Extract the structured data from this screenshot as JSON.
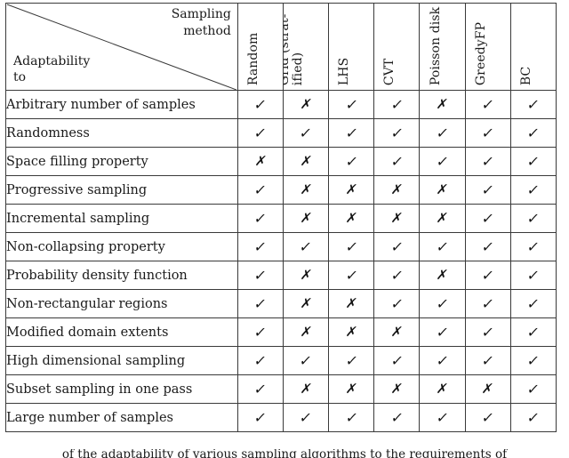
{
  "table": {
    "corner": {
      "top_right_line1": "Sampling",
      "top_right_line2": "method",
      "bottom_left_line1": "Adaptability",
      "bottom_left_line2": "to"
    },
    "columns": [
      {
        "label": "Random",
        "two_line": false
      },
      {
        "label": "Grid (strat-ified)",
        "two_line": true,
        "line1": "Grid  (strat-",
        "line2": "ified)"
      },
      {
        "label": "LHS",
        "two_line": false
      },
      {
        "label": "CVT",
        "two_line": false
      },
      {
        "label": "Poisson disk",
        "two_line": false
      },
      {
        "label": "GreedyFP",
        "two_line": false
      },
      {
        "label": "BC",
        "two_line": false
      }
    ],
    "marks": {
      "yes": "✓",
      "no": "✗"
    },
    "rows": [
      {
        "label": "Arbitrary number of samples",
        "cells": [
          "yes",
          "no",
          "yes",
          "yes",
          "no",
          "yes",
          "yes"
        ]
      },
      {
        "label": "Randomness",
        "cells": [
          "yes",
          "yes",
          "yes",
          "yes",
          "yes",
          "yes",
          "yes"
        ]
      },
      {
        "label": "Space filling property",
        "cells": [
          "no",
          "no",
          "yes",
          "yes",
          "yes",
          "yes",
          "yes"
        ]
      },
      {
        "label": "Progressive sampling",
        "cells": [
          "yes",
          "no",
          "no",
          "no",
          "no",
          "yes",
          "yes"
        ]
      },
      {
        "label": "Incremental sampling",
        "cells": [
          "yes",
          "no",
          "no",
          "no",
          "no",
          "yes",
          "yes"
        ]
      },
      {
        "label": "Non-collapsing property",
        "cells": [
          "yes",
          "yes",
          "yes",
          "yes",
          "yes",
          "yes",
          "yes"
        ]
      },
      {
        "label": "Probability density function",
        "cells": [
          "yes",
          "no",
          "yes",
          "yes",
          "no",
          "yes",
          "yes"
        ]
      },
      {
        "label": "Non-rectangular regions",
        "cells": [
          "yes",
          "no",
          "no",
          "yes",
          "yes",
          "yes",
          "yes"
        ]
      },
      {
        "label": "Modified domain extents",
        "cells": [
          "yes",
          "no",
          "no",
          "no",
          "yes",
          "yes",
          "yes"
        ]
      },
      {
        "label": "High dimensional sampling",
        "cells": [
          "yes",
          "yes",
          "yes",
          "yes",
          "yes",
          "yes",
          "yes"
        ]
      },
      {
        "label": "Subset sampling in one pass",
        "cells": [
          "yes",
          "no",
          "no",
          "no",
          "no",
          "no",
          "yes"
        ]
      },
      {
        "label": "Large number of samples",
        "cells": [
          "yes",
          "yes",
          "yes",
          "yes",
          "yes",
          "yes",
          "yes"
        ]
      }
    ]
  },
  "caption": {
    "text": "of the adaptability of various sampling algorithms to the requirements of"
  }
}
